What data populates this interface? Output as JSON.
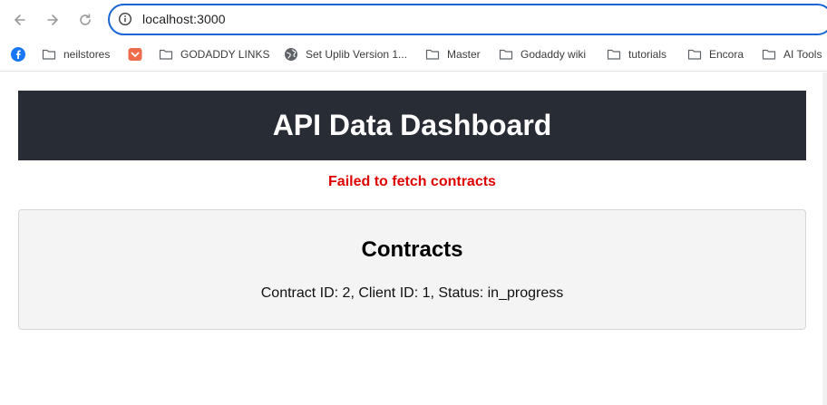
{
  "browser": {
    "url": "localhost:3000",
    "accent_color": "#1a66d2",
    "nav": {
      "back_icon": "arrow-left-icon",
      "forward_icon": "arrow-right-icon",
      "reload_icon": "reload-icon",
      "info_icon": "info-icon"
    },
    "bookmarks": [
      {
        "label": "",
        "icon": "facebook-icon"
      },
      {
        "label": "neilstores",
        "icon": "folder-icon"
      },
      {
        "label": "",
        "icon": "pocket-icon"
      },
      {
        "label": "GODADDY LINKS",
        "icon": "folder-icon"
      },
      {
        "label": "Set Uplib Version 1...",
        "icon": "globe-icon"
      },
      {
        "label": "Master",
        "icon": "folder-icon"
      },
      {
        "label": "Godaddy wiki",
        "icon": "folder-icon"
      },
      {
        "label": "tutorials",
        "icon": "folder-icon"
      },
      {
        "label": "Encora",
        "icon": "folder-icon"
      },
      {
        "label": "AI Tools",
        "icon": "folder-icon"
      }
    ]
  },
  "page": {
    "title": "API Data Dashboard",
    "header_bg": "#282c34",
    "error_message": "Failed to fetch contracts",
    "error_color": "#e00000",
    "contracts": {
      "heading": "Contracts",
      "items": [
        {
          "text": "Contract ID: 2, Client ID: 1, Status: in_progress"
        }
      ]
    }
  }
}
